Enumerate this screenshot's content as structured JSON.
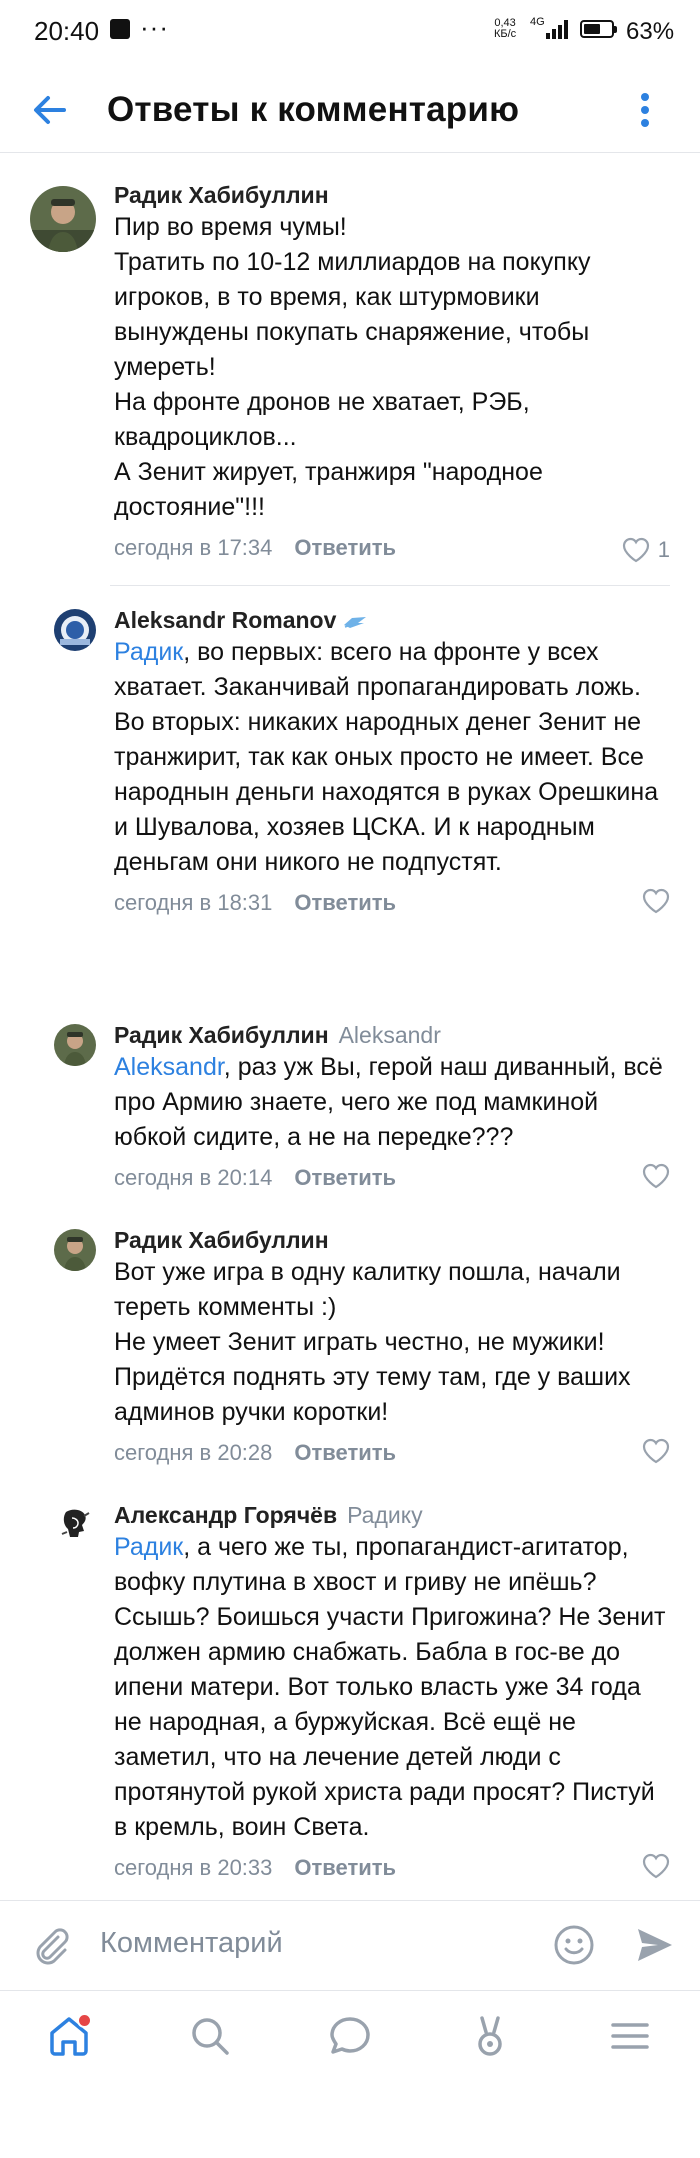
{
  "status_bar": {
    "time": "20:40",
    "speed_value": "0,43",
    "speed_unit": "КБ/с",
    "network": "4G",
    "battery_level": 0.63,
    "battery_percent": "63%"
  },
  "header": {
    "title": "Ответы к комментарию",
    "back_icon": "arrow-left-icon",
    "more_icon": "more-vertical-icon",
    "accent": "#2d81e0"
  },
  "comments": [
    {
      "author": "Радик Хабибуллин",
      "reply_to": "",
      "mention": "",
      "mention_sep": "",
      "lines": [
        "Пир во время чумы!",
        "Тратить по 10-12 миллиардов на покупку игроков, в то время, как штурмовики вынуждены покупать снаряжение, чтобы умереть!",
        "На фронте дронов не хватает, РЭБ, квадроциклов...",
        "А Зенит жирует, транжиря \"народное достояние\"!!!"
      ],
      "time": "сегодня в 17:34",
      "reply_label": "Ответить",
      "likes": "1"
    },
    {
      "author": "Aleksandr Romanov",
      "reply_to": "",
      "mention": "Радик",
      "mention_sep": ", во первых: всего на фронте у всех хватает. Заканчивай пропагандировать ложь.",
      "lines": [
        "Во вторых: никаких народных денег Зенит не транжирит, так как оных просто не имеет. Все народнын деньги находятся в руках Орешкина и Шувалова, хозяев ЦСКА. И к народным деньгам они никого не подпустят."
      ],
      "time": "сегодня в 18:31",
      "reply_label": "Ответить",
      "likes": ""
    },
    {
      "author": "Радик Хабибуллин",
      "reply_to": "Aleksandr",
      "mention": "Aleksandr",
      "mention_sep": ", раз уж Вы, герой наш диванный, всё про Армию знаете, чего же под мамкиной юбкой сидите, а не на передке???",
      "lines": [],
      "time": "сегодня в 20:14",
      "reply_label": "Ответить",
      "likes": ""
    },
    {
      "author": "Радик Хабибуллин",
      "reply_to": "",
      "mention": "",
      "mention_sep": "",
      "lines": [
        "Вот уже игра в одну калитку пошла, начали тереть комменты :)",
        "Не умеет Зенит играть честно, не мужики!",
        "Придётся поднять эту тему там, где у ваших админов ручки коротки!"
      ],
      "time": "сегодня в 20:28",
      "reply_label": "Ответить",
      "likes": ""
    },
    {
      "author": "Александр Горячёв",
      "reply_to": "Радику",
      "mention": "Радик",
      "mention_sep": ", а чего же ты, пропагандист-агитатор, вофку плутина в хвост и гриву не ипёшь? Ссышь? Боишься участи Пригожина? Не Зенит должен армию снабжать. Бабла в гос-ве до ипени матери. Вот только власть уже 34 года не народная, а буржуйская. Всё ещё не заметил, что на лечение детей люди с протянутой рукой христа ради просят? Пистуй в кремль, воин Света.",
      "lines": [],
      "time": "сегодня в 20:33",
      "reply_label": "Ответить",
      "likes": ""
    }
  ],
  "composer": {
    "placeholder": "Комментарий",
    "attach_icon": "paperclip-icon",
    "emoji_icon": "smile-icon",
    "send_icon": "send-icon"
  },
  "bottom_nav": {
    "items": [
      "home-icon",
      "search-icon",
      "messages-icon",
      "clips-icon",
      "menu-icon"
    ],
    "active": "home-icon",
    "notification_color": "#e64646"
  }
}
